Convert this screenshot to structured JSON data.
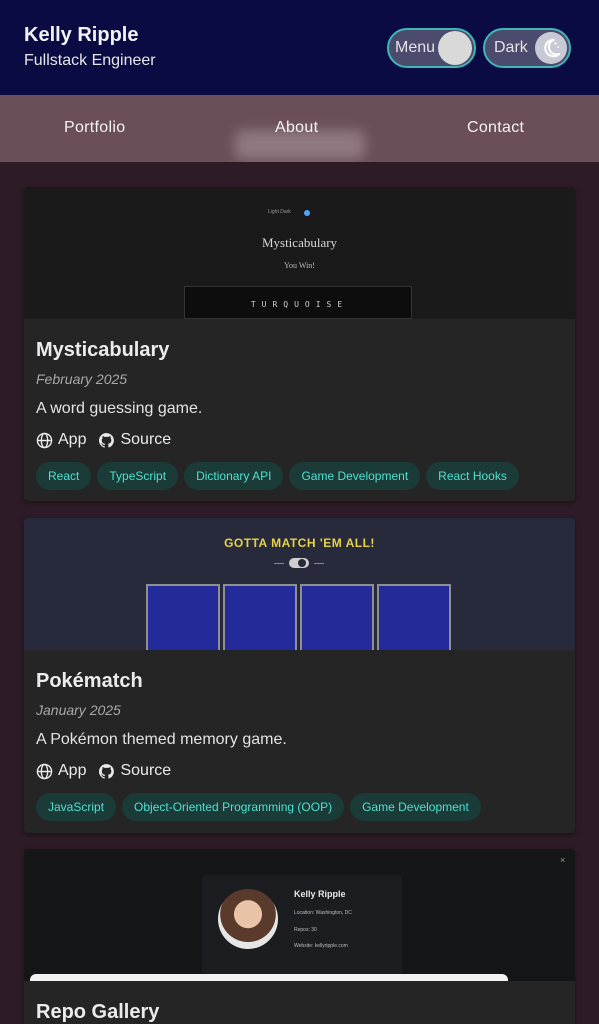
{
  "header": {
    "name": "Kelly Ripple",
    "role": "Fullstack Engineer",
    "menu_toggle_label": "Menu",
    "theme_toggle_label": "Dark"
  },
  "nav": {
    "items": [
      {
        "label": "Portfolio"
      },
      {
        "label": "About"
      },
      {
        "label": "Contact"
      }
    ]
  },
  "projects": [
    {
      "title": "Mysticabulary",
      "date": "February 2025",
      "description": "A word guessing game.",
      "app_label": "App",
      "source_label": "Source",
      "tags": [
        "React",
        "TypeScript",
        "Dictionary API",
        "Game Development",
        "React Hooks"
      ],
      "thumbnail": {
        "title": "Mysticabulary",
        "subtitle": "You Win!",
        "topbar": "Light Dark",
        "word": "TURQUOISE"
      }
    },
    {
      "title": "Pokématch",
      "date": "January 2025",
      "description": "A Pokémon themed memory game.",
      "app_label": "App",
      "source_label": "Source",
      "tags": [
        "JavaScript",
        "Object-Oriented Programming (OOP)",
        "Game Development"
      ],
      "thumbnail": {
        "title": "GOTTA MATCH 'EM ALL!"
      }
    },
    {
      "title": "Repo Gallery",
      "thumbnail": {
        "name": "Kelly Ripple",
        "location": "Location: Washington, DC",
        "repos": "Repos: 30",
        "website": "Website: kellyripple.com"
      }
    }
  ],
  "colors": {
    "header_bg": "#0b0b44",
    "page_bg": "#2e1b28",
    "tag_text": "#4fe0cf",
    "tag_bg": "#1b3b38",
    "toggle_border": "#3fb6b6"
  },
  "icons": {
    "app": "globe-icon",
    "source": "github-icon",
    "theme": "moon-icon"
  }
}
